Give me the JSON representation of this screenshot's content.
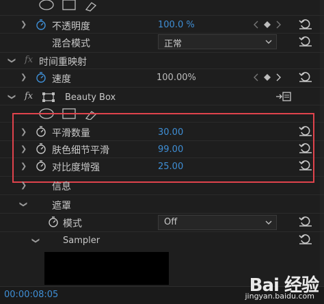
{
  "opacity": {
    "label": "不透明度",
    "value": "100.0 %"
  },
  "blend_mode": {
    "label": "混合模式",
    "value": "正常"
  },
  "time_remap": {
    "label": "时间重映射",
    "fx": "fx"
  },
  "speed": {
    "label": "速度",
    "value": "100.00%"
  },
  "beauty_box": {
    "label": "Beauty Box",
    "fx": "fx"
  },
  "params": [
    {
      "label": "平滑数量",
      "value": "30.00"
    },
    {
      "label": "肤色细节平滑",
      "value": "99.00"
    },
    {
      "label": "对比度增强",
      "value": "25.00"
    }
  ],
  "info": {
    "label": "信息"
  },
  "mask": {
    "label": "遮罩"
  },
  "mode": {
    "label": "模式",
    "value": "Off"
  },
  "sampler": {
    "label": "Sampler"
  },
  "timecode": "00:00:08:05",
  "watermark": {
    "brand": "Bai 经验",
    "url": "jingyan.baidu.com"
  },
  "colors": {
    "accent": "#3f8fd6",
    "highlight": "#e0434c",
    "background": "#1e1e1e"
  }
}
